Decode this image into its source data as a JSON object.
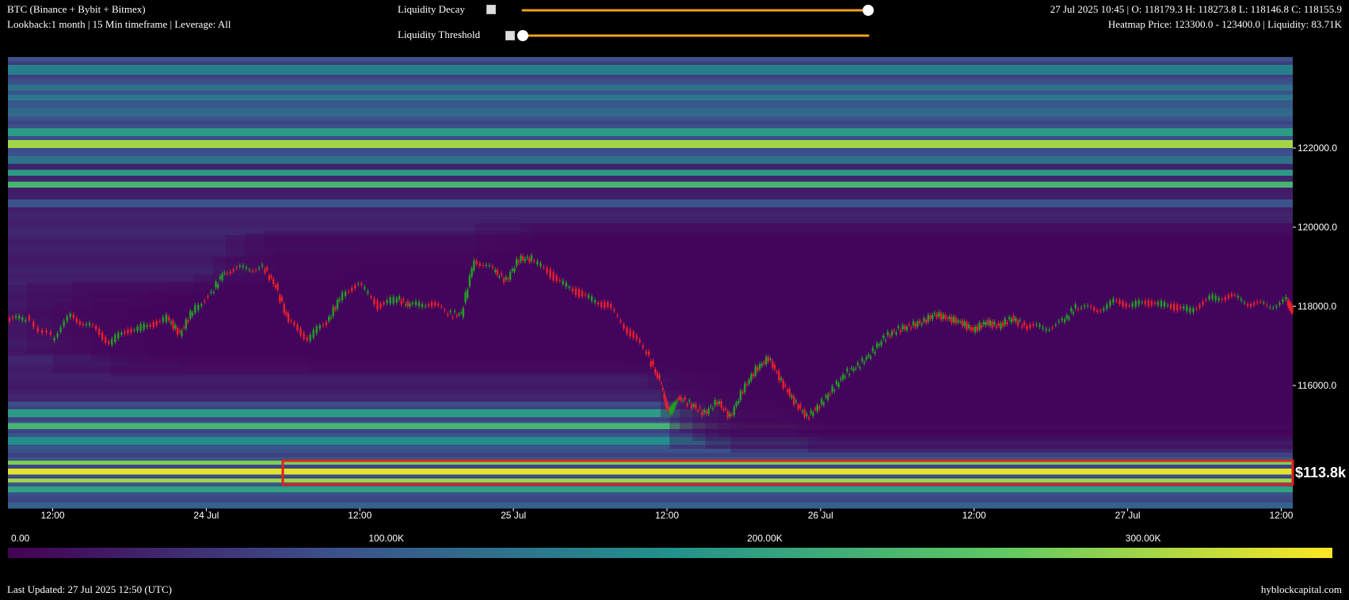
{
  "header": {
    "instrument": "BTC (Binance + Bybit + Bitmex)",
    "settings": "Lookback:1 month | 15 Min timeframe | Leverage: All",
    "ohlc": "27 Jul 2025 10:45 | O: 118179.3 H: 118273.8 L: 118146.8 C: 118155.9",
    "heatmap_info": "Heatmap Price: 123300.0 - 123400.0 | Liquidity: 83.71K"
  },
  "controls": {
    "decay_label": "Liquidity Decay",
    "threshold_label": "Liquidity Threshold",
    "decay_value": 1.0,
    "threshold_value": 0.0,
    "slider_color": "#f0a020"
  },
  "footer": {
    "last_updated": "Last Updated: 27 Jul 2025 12:50 (UTC)",
    "brand": "hyblockcapital.com"
  },
  "annotation": {
    "label": "$113.8k",
    "box_color": "#e02020",
    "price_low": 113500,
    "price_high": 114100
  },
  "chart_data": {
    "type": "heatmap",
    "title": "",
    "y_ticks": [
      "122000.0",
      "120000.0",
      "118000.0",
      "116000.0"
    ],
    "y_tick_values": [
      122000,
      120000,
      118000,
      116000
    ],
    "ylim": [
      112900,
      124300
    ],
    "x_ticks": [
      "12:00",
      "24 Jul",
      "12:00",
      "25 Jul",
      "12:00",
      "26 Jul",
      "12:00",
      "27 Jul",
      "12:00"
    ],
    "x_tick_hours": [
      12,
      24,
      36,
      48,
      60,
      72,
      84,
      96,
      108
    ],
    "xlim_hours": [
      8.5,
      108.9
    ],
    "x_origin": "23 Jul 2025 00:00 UTC",
    "colorbar": {
      "tick_labels": [
        "0.00",
        "100.00K",
        "200.00K",
        "300.00K"
      ],
      "tick_values": [
        0,
        100000,
        200000,
        300000
      ],
      "max": 350000,
      "stops": [
        "#440154",
        "#3b528b",
        "#21918c",
        "#5ec962",
        "#fde725"
      ]
    },
    "up_color": "#22a022",
    "down_color": "#e8202a",
    "price_path": [
      [
        8.5,
        117650
      ],
      [
        10,
        117700
      ],
      [
        12,
        117200
      ],
      [
        13.5,
        117750
      ],
      [
        15,
        117500
      ],
      [
        16.5,
        117100
      ],
      [
        18,
        117400
      ],
      [
        19.5,
        117500
      ],
      [
        21,
        117700
      ],
      [
        22,
        117300
      ],
      [
        23,
        117900
      ],
      [
        24.5,
        118350
      ],
      [
        25.5,
        118900
      ],
      [
        27,
        118950
      ],
      [
        28.5,
        119000
      ],
      [
        29.5,
        118500
      ],
      [
        30.5,
        117600
      ],
      [
        32,
        117200
      ],
      [
        33.5,
        117600
      ],
      [
        34.5,
        118200
      ],
      [
        36,
        118600
      ],
      [
        37.5,
        118000
      ],
      [
        39,
        118200
      ],
      [
        40,
        118000
      ],
      [
        41.5,
        118100
      ],
      [
        43,
        117800
      ],
      [
        44,
        117800
      ],
      [
        45,
        119200
      ],
      [
        46.5,
        118900
      ],
      [
        47.5,
        118650
      ],
      [
        48.5,
        119200
      ],
      [
        49.5,
        119200
      ],
      [
        51,
        118800
      ],
      [
        52.5,
        118450
      ],
      [
        54,
        118200
      ],
      [
        55.5,
        118000
      ],
      [
        57,
        117400
      ],
      [
        58.5,
        116800
      ],
      [
        59.5,
        116100
      ],
      [
        60.2,
        115300
      ],
      [
        61,
        115700
      ],
      [
        62,
        115500
      ],
      [
        63,
        115300
      ],
      [
        64,
        115600
      ],
      [
        65,
        115200
      ],
      [
        66,
        115900
      ],
      [
        67,
        116400
      ],
      [
        68,
        116700
      ],
      [
        69,
        116100
      ],
      [
        70,
        115600
      ],
      [
        71,
        115200
      ],
      [
        72,
        115500
      ],
      [
        73,
        115900
      ],
      [
        74,
        116300
      ],
      [
        75,
        116500
      ],
      [
        76,
        116800
      ],
      [
        77,
        117200
      ],
      [
        78,
        117400
      ],
      [
        79,
        117500
      ],
      [
        80,
        117600
      ],
      [
        81,
        117800
      ],
      [
        82,
        117700
      ],
      [
        83,
        117600
      ],
      [
        84,
        117400
      ],
      [
        85,
        117600
      ],
      [
        86,
        117500
      ],
      [
        87,
        117700
      ],
      [
        88,
        117500
      ],
      [
        89.5,
        117450
      ],
      [
        91,
        117600
      ],
      [
        92,
        118000
      ],
      [
        93.5,
        117900
      ],
      [
        95,
        118100
      ],
      [
        96.5,
        118050
      ],
      [
        98,
        118100
      ],
      [
        99.5,
        118000
      ],
      [
        101,
        117900
      ],
      [
        102.5,
        118200
      ],
      [
        104,
        118250
      ],
      [
        105.5,
        118100
      ],
      [
        107,
        118000
      ],
      [
        108.5,
        118150
      ],
      [
        108.9,
        117900
      ]
    ],
    "liquidity_bands": [
      {
        "low": 123850,
        "high": 124100,
        "value": 150000
      },
      {
        "low": 123450,
        "high": 123600,
        "value": 130000
      },
      {
        "low": 123200,
        "high": 123350,
        "value": 140000
      },
      {
        "low": 122800,
        "high": 123000,
        "value": 120000
      },
      {
        "low": 122300,
        "high": 122500,
        "value": 190000
      },
      {
        "low": 122000,
        "high": 122200,
        "value": 300000
      },
      {
        "low": 121600,
        "high": 121800,
        "value": 130000
      },
      {
        "low": 121300,
        "high": 121450,
        "value": 190000
      },
      {
        "low": 121000,
        "high": 121150,
        "value": 230000
      },
      {
        "low": 120500,
        "high": 120700,
        "value": 90000
      },
      {
        "low": 115200,
        "high": 115400,
        "value": 190000
      },
      {
        "low": 114900,
        "high": 115050,
        "value": 230000
      },
      {
        "low": 114500,
        "high": 114700,
        "value": 170000
      },
      {
        "low": 114000,
        "high": 114100,
        "value": 280000
      },
      {
        "low": 113750,
        "high": 113900,
        "value": 335000
      },
      {
        "low": 113550,
        "high": 113650,
        "value": 300000
      },
      {
        "low": 113300,
        "high": 113450,
        "value": 200000
      },
      {
        "low": 112900,
        "high": 113050,
        "value": 110000
      }
    ]
  }
}
